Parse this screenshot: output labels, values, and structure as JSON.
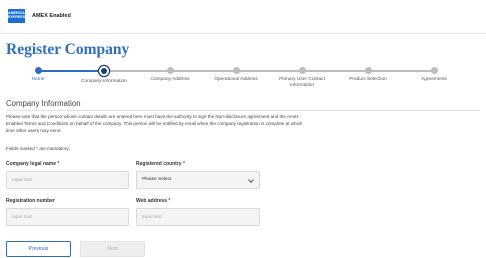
{
  "header": {
    "logo_text": "AMERICAN EXPRESS",
    "brand": "AMEX Enabled"
  },
  "page": {
    "title": "Register Company"
  },
  "stepper": {
    "steps": [
      {
        "label": "Home",
        "state": "done"
      },
      {
        "label": "Company Information",
        "state": "current"
      },
      {
        "label": "Company Address",
        "state": "upcoming"
      },
      {
        "label": "Operational Address",
        "state": "upcoming"
      },
      {
        "label": "Primary User Contact Information",
        "state": "upcoming"
      },
      {
        "label": "Product Selection",
        "state": "upcoming"
      },
      {
        "label": "Agreements",
        "state": "upcoming"
      }
    ],
    "colors": {
      "done": "#2e6ec0",
      "current": "#1b3c73",
      "upcoming": "#b9bcc2"
    }
  },
  "section": {
    "title": "Company Information",
    "notice": "Please note that the person whose contact details are entered here must have the authority to sign the Non-disclosure agreement and the Amex Enabled Terms and Conditions on behalf of the company. This person will be notified by email when the company registration is complete at which time other users may enrol.",
    "mandatory_note": "Fields marked * are mandatory."
  },
  "form": {
    "legal_name": {
      "label": "Company legal name",
      "required_mark": " *",
      "placeholder": "Input text",
      "value": ""
    },
    "country": {
      "label": "Registered country",
      "required_mark": " *",
      "selected": "Please Select"
    },
    "registration_number": {
      "label": "Registration number",
      "placeholder": "Input text",
      "value": ""
    },
    "web_address": {
      "label": "Web address",
      "required_mark": " *",
      "placeholder": "Input text",
      "value": ""
    }
  },
  "buttons": {
    "previous": "Previous",
    "next": "Next"
  }
}
